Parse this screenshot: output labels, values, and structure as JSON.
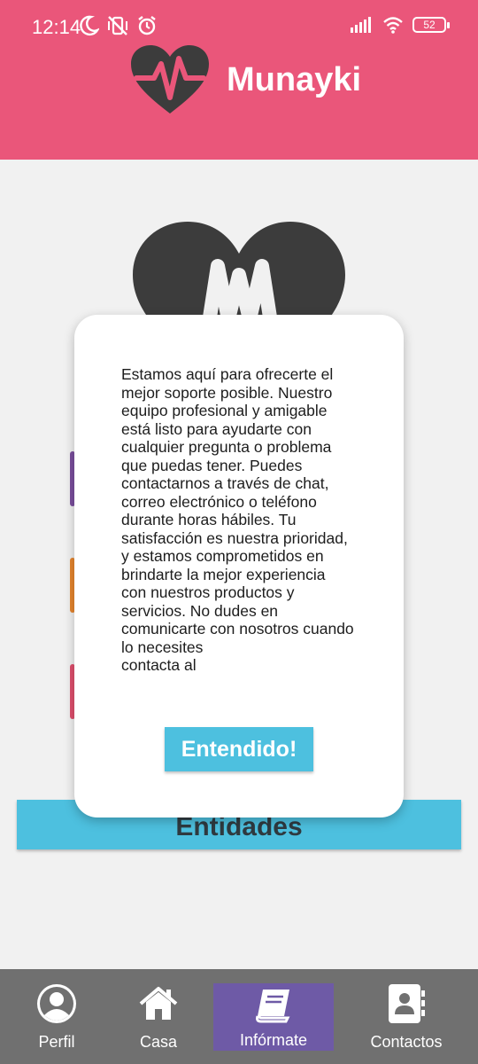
{
  "status_bar": {
    "time": "12:14",
    "battery": "52"
  },
  "header": {
    "app_title": "Munayki",
    "logo_icon": "heart-pulse-icon"
  },
  "background": {
    "bar_colors": [
      "#7b4f9e",
      "#e7862e",
      "#e0506e"
    ],
    "entidades_label": "Entidades"
  },
  "dialog": {
    "message": "Estamos aquí para ofrecerte el\nmejor soporte posible. Nuestro\nequipo profesional y amigable\nestá listo para ayudarte con\ncualquier pregunta o problema\nque puedas tener. Puedes\ncontactarnos a través de chat,\ncorreo electrónico o teléfono\ndurante horas hábiles. Tu\nsatisfacción es nuestra prioridad,\ny estamos comprometidos en\nbrindarte la mejor experiencia\ncon nuestros productos y\nservicios. No dudes en\ncomunicarte con nosotros cuando\nlo necesites\ncontacta al",
    "button_label": "Entendido!"
  },
  "bottom_nav": {
    "items": [
      {
        "label": "Perfil",
        "icon": "user-icon"
      },
      {
        "label": "Casa",
        "icon": "home-icon"
      },
      {
        "label": "Infórmate",
        "icon": "book-icon",
        "active": true
      },
      {
        "label": "Contactos",
        "icon": "contacts-icon"
      }
    ]
  },
  "colors": {
    "header": "#ea567a",
    "accent": "#4dc0df",
    "nav_bg": "#707070",
    "nav_active": "#6e5aa6"
  }
}
